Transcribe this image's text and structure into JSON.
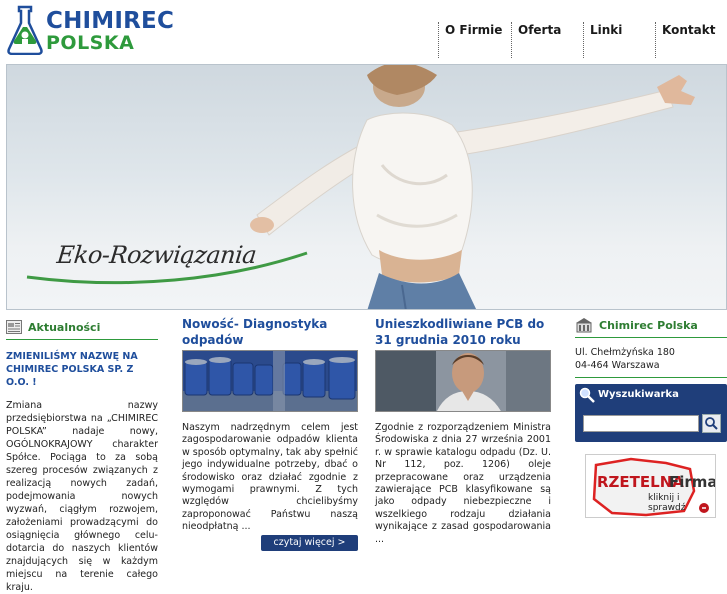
{
  "logo": {
    "line1": "CHIMIREC",
    "line2": "POLSKA"
  },
  "nav": [
    "O Firmie",
    "Oferta",
    "Linki",
    "Kontakt"
  ],
  "hero": {
    "caption": "Eko-Rozwiązania"
  },
  "news": {
    "heading": "Aktualności",
    "title": "ZMIENILIŚMY NAZWĘ NA CHIMIREC POLSKA SP. Z O.O. !",
    "body": "Zmiana nazwy przedsiębiorstwa na „CHIMIREC POLSKA” nadaje nowy, OGÓLNOKRAJOWY charakter Spółce. Pociąga to za sobą szereg procesów związanych z realizacją nowych zadań, podejmowania nowych wyzwań, ciągłym rozwojem, założeniami prowadzącymi do osiągnięcia głównego celu-dotarcia do naszych klientów znajdujących się w każdym miejscu na terenie całego kraju."
  },
  "articles": [
    {
      "title": "Nowość- Diagnostyka odpadów",
      "body": "Naszym nadrzędnym celem jest zagospodarowanie odpadów klienta w sposób optymalny, tak aby spełnić jego indywidualne potrzeby, dbać o środowisko oraz działać zgodnie z wymogami prawnymi. Z tych względów chcielibyśmy zaproponować Państwu naszą nieodpłatną ...",
      "more": "czytaj więcej >"
    },
    {
      "title": "Unieszkodliwiane PCB do 31 grudnia 2010 roku",
      "body": "Zgodnie z rozporządzeniem Ministra Środowiska z dnia 27 września 2001 r. w sprawie katalogu odpadu (Dz. U. Nr 112, poz. 1206) oleje przepracowane oraz urządzenia zawierające PCB klasyfikowane są jako odpady niebezpieczne i wszelkiego rodzaju działania wynikające z zasad gospodarowania ..."
    }
  ],
  "company": {
    "heading": "Chimirec Polska",
    "street": "Ul. Chełmżyńska 180",
    "city": "04-464 Warszawa"
  },
  "search": {
    "title": "Wyszukiwarka",
    "placeholder": ""
  },
  "badge": {
    "word1": "RZETELNA",
    "word2": "Firma",
    "tagline": "kliknij i sprawdź"
  },
  "colors": {
    "brand_blue": "#1f4e9c",
    "brand_green": "#2e9a3c",
    "navy": "#1f3e7a",
    "badge_red": "#c0161d"
  }
}
